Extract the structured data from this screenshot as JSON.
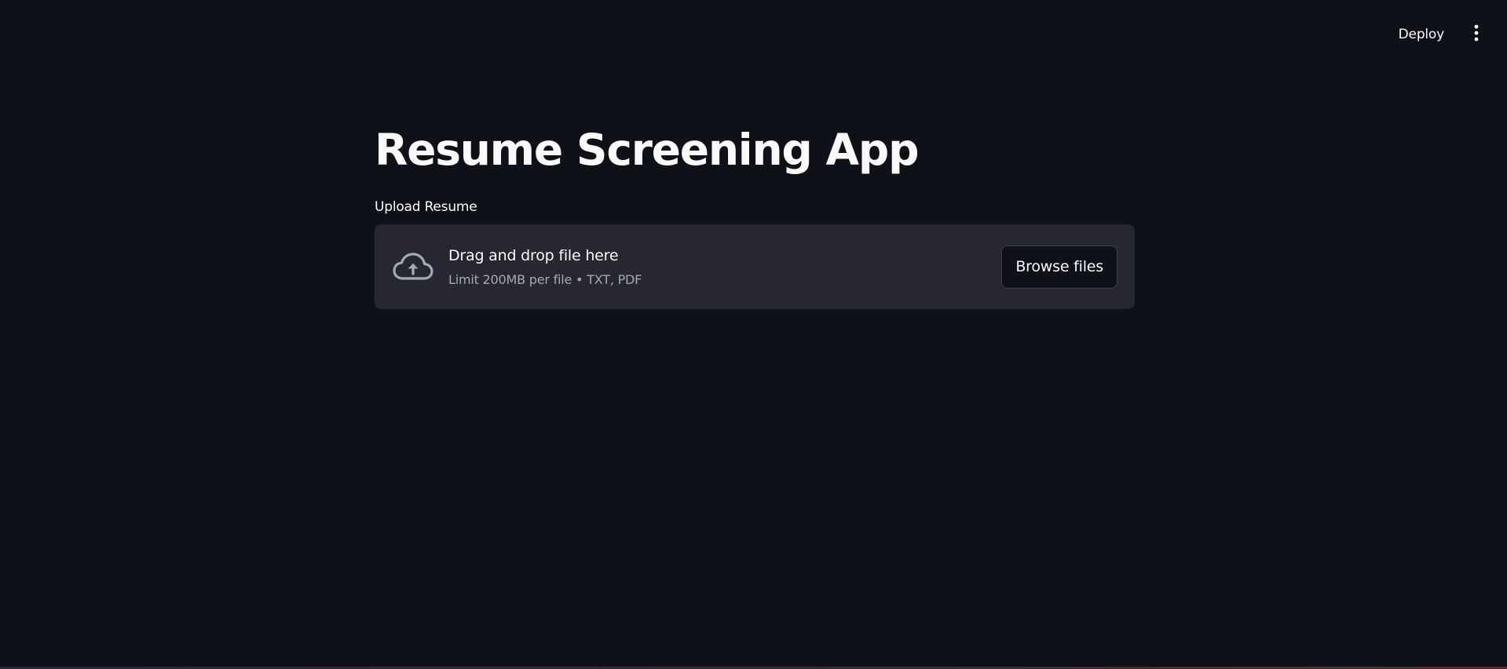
{
  "toolbar": {
    "deploy_label": "Deploy",
    "menu_icon": "vertical-ellipsis-icon"
  },
  "main": {
    "title": "Resume Screening App",
    "uploader": {
      "label": "Upload Resume",
      "icon": "cloud-upload-icon",
      "instruction": "Drag and drop file here",
      "limit_text": "Limit 200MB per file • TXT, PDF",
      "browse_label": "Browse files"
    }
  },
  "colors": {
    "background": "#0e1117",
    "dropzone_bg": "#262730",
    "text_primary": "#fafafa",
    "text_secondary": "#a3a8b8"
  }
}
